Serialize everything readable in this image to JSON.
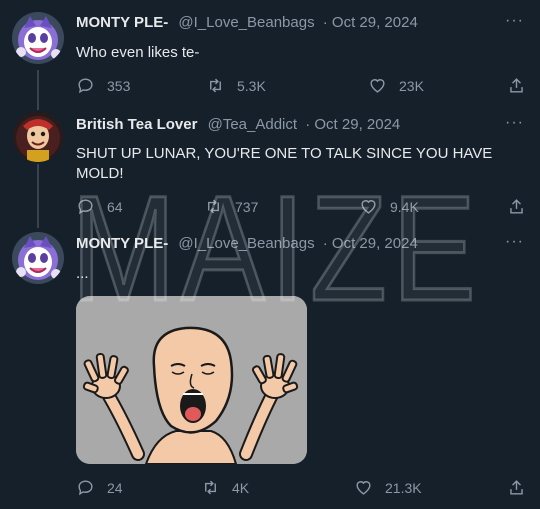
{
  "tweets": [
    {
      "name": "MONTY PLE-",
      "handle": "@I_Love_Beanbags",
      "date": "· Oct 29, 2024",
      "text": "Who even likes te-",
      "replies": "353",
      "retweets": "5.3K",
      "likes": "23K"
    },
    {
      "name": "British Tea Lover",
      "handle": "@Tea_Addict",
      "date": "· Oct 29, 2024",
      "text": "SHUT UP LUNAR, YOU'RE ONE TO TALK SINCE YOU HAVE MOLD!",
      "replies": "64",
      "retweets": "737",
      "likes": "9.4K"
    },
    {
      "name": "MONTY PLE-",
      "handle": "@I_Love_Beanbags",
      "date": "· Oct 29, 2024",
      "text": "...",
      "replies": "24",
      "retweets": "4K",
      "likes": "21.3K",
      "media": "wojak-screaming-meme"
    }
  ],
  "more_label": "···",
  "watermark": "MAIZE",
  "colors": {
    "background": "#15202b",
    "text": "#e7e9ea",
    "muted": "#8b98a5",
    "thread_line": "#38444d"
  },
  "icons": {
    "reply": "reply-icon",
    "retweet": "retweet-icon",
    "like": "heart-icon",
    "share": "share-icon"
  }
}
